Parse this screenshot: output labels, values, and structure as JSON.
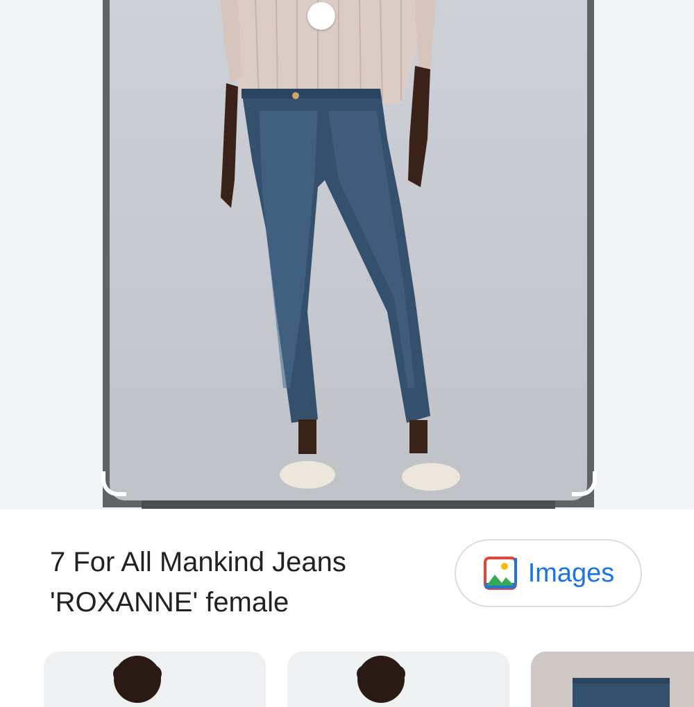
{
  "result": {
    "title_line1": "7 For All Mankind Jeans",
    "title_line2": "'ROXANNE' female"
  },
  "images_chip": {
    "label": "Images",
    "icon": "image-icon"
  },
  "colors": {
    "accent": "#1a73e8",
    "frame": "#5f6368",
    "title_text": "#202124"
  },
  "thumbnails": [
    {
      "icon": "person-photo"
    },
    {
      "icon": "person-photo"
    },
    {
      "icon": "jeans-photo"
    }
  ]
}
